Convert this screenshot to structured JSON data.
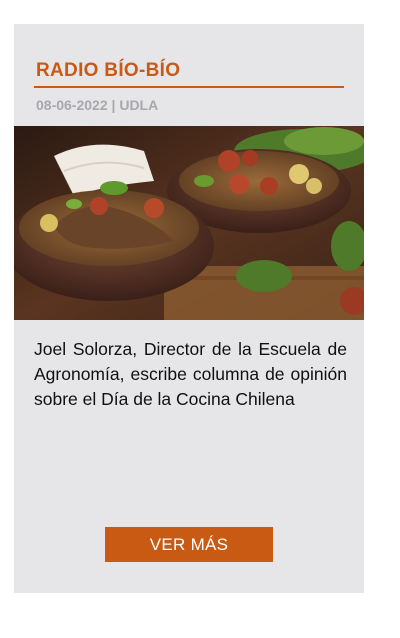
{
  "card": {
    "source": "RADIO BÍO-BÍO",
    "date": "08-06-2022",
    "separator": "|",
    "institution": "UDLA",
    "image": {
      "name": "chilean-cuisine-stew-bowls-photo"
    },
    "description": "Joel Solorza, Director de la Escuela de Agronomía, escribe columna de opinión sobre el Día de la Cocina Chilena",
    "button_label": "VER MÁS"
  },
  "colors": {
    "accent": "#c85a14",
    "card_background": "#e6e6e9",
    "meta_text": "#a8a8ac"
  }
}
